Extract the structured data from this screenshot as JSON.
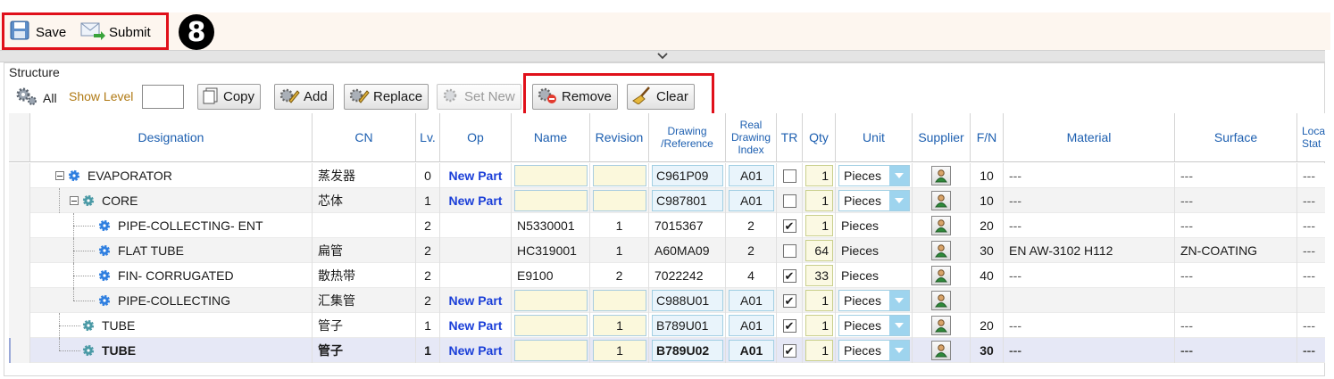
{
  "toolbar": {
    "save_label": "Save",
    "submit_label": "Submit",
    "step_badge": "8"
  },
  "structure": {
    "title": "Structure",
    "all_label": "All",
    "show_level_label": "Show Level",
    "show_level_value": "",
    "buttons": {
      "copy": "Copy",
      "add": "Add",
      "replace": "Replace",
      "set_new": "Set New",
      "remove": "Remove",
      "clear": "Clear"
    }
  },
  "grid": {
    "headers": {
      "designation": "Designation",
      "cn": "CN",
      "lv": "Lv.",
      "op": "Op",
      "name": "Name",
      "revision": "Revision",
      "drawing_ref": "Drawing /Reference",
      "real_drawing_index": "Real Drawing Index",
      "tr": "TR",
      "qty": "Qty",
      "unit": "Unit",
      "supplier": "Supplier",
      "fn": "F/N",
      "material": "Material",
      "surface": "Surface",
      "local_status": "Local Stat"
    },
    "rows": [
      {
        "designation": "EVAPORATOR",
        "cn": "蒸发器",
        "lv": "0",
        "op": "New Part",
        "name": "",
        "revision": "",
        "drawing": "C961P09",
        "index": "A01",
        "tr": false,
        "qty": "1",
        "unit": "Pieces",
        "fn": "10",
        "material": "---",
        "surface": "---",
        "local": "---"
      },
      {
        "designation": "CORE",
        "cn": "芯体",
        "lv": "1",
        "op": "New Part",
        "name": "",
        "revision": "",
        "drawing": "C987801",
        "index": "A01",
        "tr": false,
        "qty": "1",
        "unit": "Pieces",
        "fn": "10",
        "material": "---",
        "surface": "---",
        "local": "---"
      },
      {
        "designation": "PIPE-COLLECTING- ENT",
        "cn": "",
        "lv": "2",
        "op": "",
        "name": "N5330001",
        "revision": "1",
        "drawing": "7015367",
        "index": "2",
        "tr": true,
        "qty": "1",
        "unit": "Pieces",
        "fn": "20",
        "material": "---",
        "surface": "---",
        "local": "---"
      },
      {
        "designation": "FLAT TUBE",
        "cn": "扁管",
        "lv": "2",
        "op": "",
        "name": "HC319001",
        "revision": "1",
        "drawing": "A60MA09",
        "index": "2",
        "tr": false,
        "qty": "64",
        "unit": "Pieces",
        "fn": "30",
        "material": "EN AW-3102 H112",
        "surface": "ZN-COATING",
        "local": "---"
      },
      {
        "designation": "FIN- CORRUGATED",
        "cn": "散热带",
        "lv": "2",
        "op": "",
        "name": "E9100",
        "revision": "2",
        "drawing": "7022242",
        "index": "4",
        "tr": true,
        "qty": "33",
        "unit": "Pieces",
        "fn": "40",
        "material": "---",
        "surface": "---",
        "local": "---"
      },
      {
        "designation": "PIPE-COLLECTING",
        "cn": "汇集管",
        "lv": "2",
        "op": "New Part",
        "name": "",
        "revision": "",
        "drawing": "C988U01",
        "index": "A01",
        "tr": true,
        "qty": "1",
        "unit": "Pieces",
        "fn": "",
        "material": "",
        "surface": "",
        "local": ""
      },
      {
        "designation": "TUBE",
        "cn": "管子",
        "lv": "1",
        "op": "New Part",
        "name": "",
        "revision": "1",
        "drawing": "B789U01",
        "index": "A01",
        "tr": true,
        "qty": "1",
        "unit": "Pieces",
        "fn": "20",
        "material": "---",
        "surface": "---",
        "local": "---"
      },
      {
        "designation": "TUBE",
        "cn": "管子",
        "lv": "1",
        "op": "New Part",
        "name": "",
        "revision": "1",
        "drawing": "B789U02",
        "index": "A01",
        "tr": true,
        "qty": "1",
        "unit": "Pieces",
        "fn": "30",
        "material": "---",
        "surface": "---",
        "local": "---"
      }
    ]
  }
}
